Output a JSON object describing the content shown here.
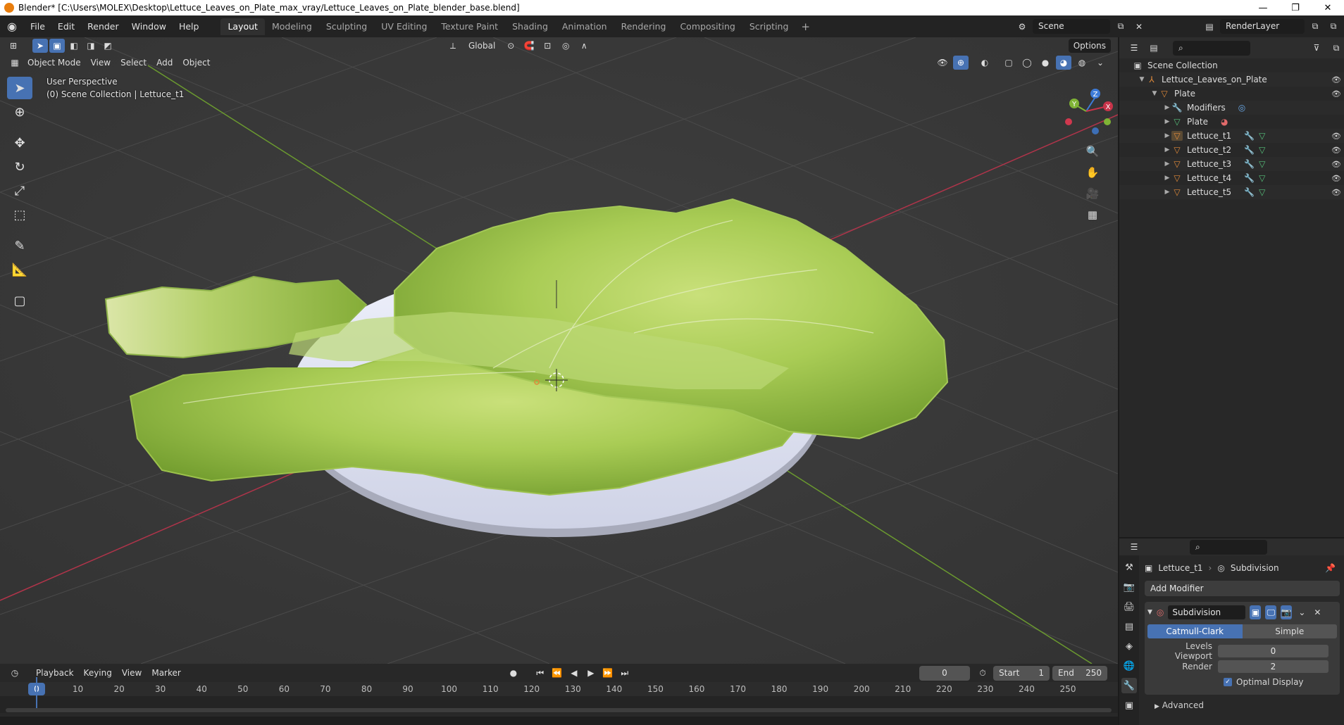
{
  "window": {
    "title": "Blender* [C:\\Users\\MOLEX\\Desktop\\Lettuce_Leaves_on_Plate_max_vray/Lettuce_Leaves_on_Plate_blender_base.blend]",
    "minimize": "—",
    "maximize": "❐",
    "close": "✕"
  },
  "menu": [
    "File",
    "Edit",
    "Render",
    "Window",
    "Help"
  ],
  "workspaces": [
    "Layout",
    "Modeling",
    "Sculpting",
    "UV Editing",
    "Texture Paint",
    "Shading",
    "Animation",
    "Rendering",
    "Compositing",
    "Scripting"
  ],
  "workspace_add": "+",
  "scene": "Scene",
  "render_layer": "RenderLayer",
  "viewport": {
    "mode": "Object Mode",
    "menus": [
      "View",
      "Select",
      "Add",
      "Object"
    ],
    "orientation": "Global",
    "options": "Options",
    "perspective_label": "User Perspective",
    "collection_label": "(0) Scene Collection | Lettuce_t1",
    "gizmo_axes": {
      "x": "X",
      "y": "Y",
      "z": "Z"
    },
    "colors": {
      "x_axis": "#c8344a",
      "y_axis": "#7fb335",
      "z_axis": "#3d7bd8",
      "accent": "#4772b3"
    }
  },
  "timeline": {
    "menus": [
      "Playback",
      "Keying",
      "View",
      "Marker"
    ],
    "current_frame": "0",
    "start_label": "Start",
    "start_value": "1",
    "end_label": "End",
    "end_value": "250",
    "ruler_ticks": [
      "0",
      "10",
      "20",
      "30",
      "40",
      "50",
      "60",
      "70",
      "80",
      "90",
      "100",
      "110",
      "120",
      "130",
      "140",
      "150",
      "160",
      "170",
      "180",
      "190",
      "200",
      "210",
      "220",
      "230",
      "240",
      "250"
    ]
  },
  "outliner": {
    "root": "Scene Collection",
    "items": [
      {
        "label": "Lettuce_Leaves_on_Plate"
      },
      {
        "label": "Plate"
      },
      {
        "label": "Modifiers"
      },
      {
        "label": "Plate"
      },
      {
        "label": "Lettuce_t1"
      },
      {
        "label": "Lettuce_t2"
      },
      {
        "label": "Lettuce_t3"
      },
      {
        "label": "Lettuce_t4"
      },
      {
        "label": "Lettuce_t5"
      }
    ]
  },
  "properties": {
    "object": "Lettuce_t1",
    "modifier_crumb": "Subdivision",
    "add_modifier": "Add Modifier",
    "modifier_name": "Subdivision",
    "algo_catmull": "Catmull-Clark",
    "algo_simple": "Simple",
    "levels_viewport_label": "Levels Viewport",
    "levels_viewport_value": "0",
    "render_label": "Render",
    "render_value": "2",
    "optimal_display": "Optimal Display",
    "advanced": "Advanced"
  }
}
